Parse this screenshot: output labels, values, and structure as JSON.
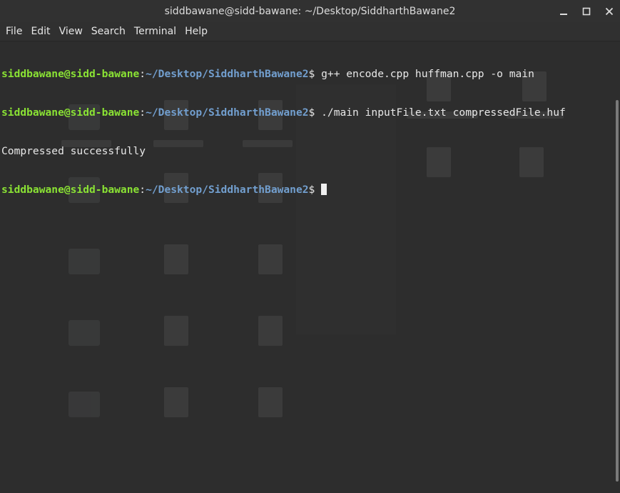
{
  "window": {
    "title": "siddbawane@sidd-bawane: ~/Desktop/SiddharthBawane2",
    "controls": [
      "minimize-icon",
      "maximize-icon",
      "close-icon"
    ]
  },
  "menu": {
    "items": [
      "File",
      "Edit",
      "View",
      "Search",
      "Terminal",
      "Help"
    ]
  },
  "terminal": {
    "lines": [
      {
        "user": "siddbawane@sidd-bawane",
        "sep": ":",
        "path": "~/Desktop/SiddharthBawane2",
        "dollar": "$ ",
        "cmd": "g++ encode.cpp huffman.cpp -o main"
      },
      {
        "user": "siddbawane@sidd-bawane",
        "sep": ":",
        "path": "~/Desktop/SiddharthBawane2",
        "dollar": "$ ",
        "cmd": "./main inputFile.txt compressedFile.huf"
      },
      {
        "output": "Compressed successfully"
      },
      {
        "user": "siddbawane@sidd-bawane",
        "sep": ":",
        "path": "~/Desktop/SiddharthBawane2",
        "dollar": "$ ",
        "cmd": ""
      }
    ]
  },
  "colors": {
    "prompt_user": "#8ae234",
    "prompt_path": "#729fcf",
    "background": "#2d2d2d",
    "text": "#e8e8e8"
  }
}
